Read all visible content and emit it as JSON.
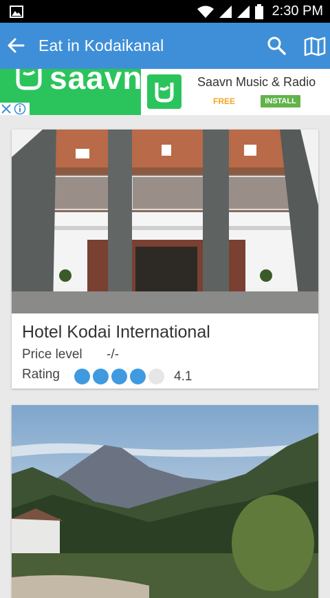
{
  "status_bar": {
    "time": "2:30 PM",
    "icons": [
      "gallery-icon",
      "wifi-icon",
      "signal-icon",
      "signal-icon",
      "battery-icon"
    ]
  },
  "app_bar": {
    "title": "Eat in Kodaikanal",
    "icons": [
      "back-arrow-icon",
      "search-icon",
      "map-icon"
    ],
    "color": "#3f8fd8"
  },
  "ad": {
    "brand": "saavn",
    "title": "Saavn Music & Radio",
    "price": "FREE",
    "install_label": "INSTALL",
    "brand_color": "#2bc45c"
  },
  "places": [
    {
      "name": "Hotel Kodai International",
      "price_label": "Price level",
      "price_value": "-/-",
      "rating_label": "Rating",
      "rating_value": "4.1",
      "rating_dots_filled": 4,
      "rating_dots_total": 5
    },
    {
      "name": "",
      "image": "mountain landscape"
    }
  ]
}
